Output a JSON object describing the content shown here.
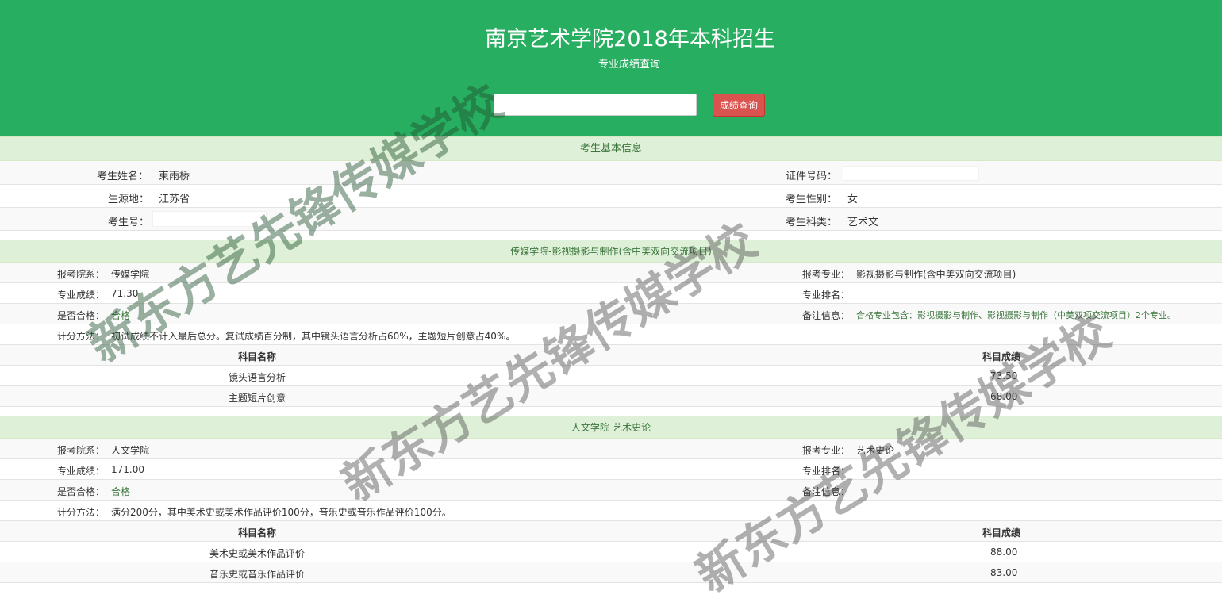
{
  "header": {
    "title": "南京艺术学院2018年本科招生",
    "subtitle": "专业成绩查询",
    "search_input_value": "",
    "search_button": "成绩查询"
  },
  "basic": {
    "section_title": "考生基本信息",
    "name_label": "考生姓名：",
    "name_value": "束雨桥",
    "id_label": "证件号码：",
    "origin_label": "生源地：",
    "origin_value": "江苏省",
    "gender_label": "考生性别：",
    "gender_value": "女",
    "exam_no_label": "考生号：",
    "category_label": "考生科类：",
    "category_value": "艺术文"
  },
  "majors": [
    {
      "section_title": "传媒学院-影视摄影与制作(含中美双向交流项目)",
      "dept_label": "报考院系：",
      "dept_value": "传媒学院",
      "major_label": "报考专业：",
      "major_value": "影视摄影与制作(含中美双向交流项目)",
      "score_label": "专业成绩：",
      "score_value": "71.30",
      "rank_label": "专业排名：",
      "rank_value": "",
      "pass_label": "是否合格：",
      "pass_value": "合格",
      "note_label": "备注信息：",
      "note_value": "合格专业包含：影视摄影与制作、影视摄影与制作（中美双项交流项目）2个专业。",
      "method_label": "计分方法：",
      "method_value": "初试成绩不计入最后总分。复试成绩百分制，其中镜头语言分析占60%，主题短片创意占40%。",
      "subject_header": "科目名称",
      "score_header": "科目成绩",
      "subjects": [
        {
          "name": "镜头语言分析",
          "score": "73.50"
        },
        {
          "name": "主题短片创意",
          "score": "68.00"
        }
      ]
    },
    {
      "section_title": "人文学院-艺术史论",
      "dept_label": "报考院系：",
      "dept_value": "人文学院",
      "major_label": "报考专业：",
      "major_value": "艺术史论",
      "score_label": "专业成绩：",
      "score_value": "171.00",
      "rank_label": "专业排名：",
      "rank_value": "",
      "pass_label": "是否合格：",
      "pass_value": "合格",
      "note_label": "备注信息：",
      "note_value": "",
      "method_label": "计分方法：",
      "method_value": "满分200分，其中美术史或美术作品评价100分，音乐史或音乐作品评价100分。",
      "subject_header": "科目名称",
      "score_header": "科目成绩",
      "subjects": [
        {
          "name": "美术史或美术作品评价",
          "score": "88.00"
        },
        {
          "name": "音乐史或音乐作品评价",
          "score": "83.00"
        }
      ]
    }
  ],
  "watermark": "新东方艺先锋传媒学校"
}
